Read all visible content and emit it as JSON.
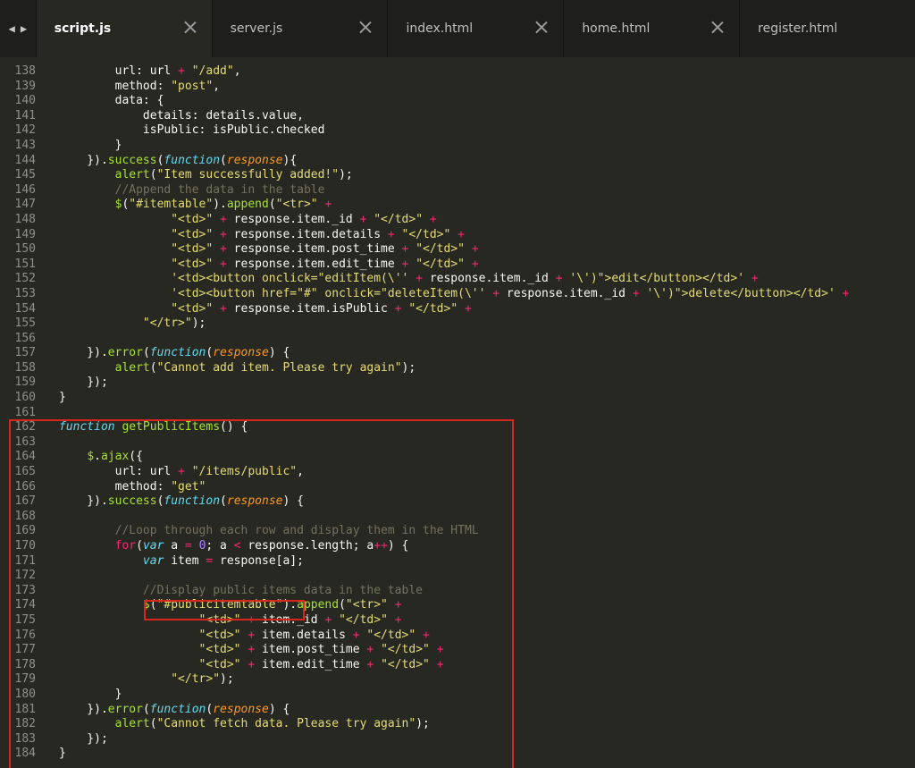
{
  "tabs": [
    {
      "label": "script.js",
      "active": true
    },
    {
      "label": "server.js",
      "active": false
    },
    {
      "label": "index.html",
      "active": false
    },
    {
      "label": "home.html",
      "active": false
    },
    {
      "label": "register.html",
      "active": false
    }
  ],
  "nav": {
    "back_icon": "triangle-left-icon",
    "forward_icon": "triangle-right-icon"
  },
  "colors": {
    "background": "#272822",
    "tabbar": "#1e1f1c",
    "highlight": "#d9261c"
  },
  "code": {
    "first_line_number": 138,
    "last_line_number": 184,
    "lines": [
      "        url: url + \"/add\",",
      "        method: \"post\",",
      "        data: {",
      "            details: details.value,",
      "            isPublic: isPublic.checked",
      "        }",
      "    }).success(function(response){",
      "        alert(\"Item successfully added!\");",
      "        //Append the data in the table",
      "        $(\"#itemtable\").append(\"<tr>\" +",
      "                \"<td>\" + response.item._id + \"</td>\" +",
      "                \"<td>\" + response.item.details + \"</td>\" +",
      "                \"<td>\" + response.item.post_time + \"</td>\" +",
      "                \"<td>\" + response.item.edit_time + \"</td>\" +",
      "                '<td><button onclick=\"editItem(\\'' + response.item._id + '\\')\">edit</button></td>' +",
      "                '<td><button href=\"#\" onclick=\"deleteItem(\\'' + response.item._id + '\\')\">delete</button></td>' +",
      "                \"<td>\" + response.item.isPublic + \"</td>\" +",
      "            \"</tr>\");",
      "",
      "    }).error(function(response) {",
      "        alert(\"Cannot add item. Please try again\");",
      "    });",
      "}",
      "",
      "function getPublicItems() {",
      "",
      "    $.ajax({",
      "        url: url + \"/items/public\",",
      "        method: \"get\"",
      "    }).success(function(response) {",
      "",
      "        //Loop through each row and display them in the HTML",
      "        for(var a = 0; a < response.length; a++) {",
      "            var item = response[a];",
      "",
      "            //Display public items data in the table",
      "            $(\"#publicitemtable\").append(\"<tr>\" +",
      "                    \"<td>\" + item._id + \"</td>\" +",
      "                    \"<td>\" + item.details + \"</td>\" +",
      "                    \"<td>\" + item.post_time + \"</td>\" +",
      "                    \"<td>\" + item.edit_time + \"</td>\" +",
      "                \"</tr>\");",
      "        }",
      "    }).error(function(response) {",
      "        alert(\"Cannot fetch data. Please try again\");",
      "    });",
      "}"
    ]
  },
  "annotations": {
    "function_box": "getPublicItems",
    "selector_box": "$(\"#publicitemtable\")"
  }
}
